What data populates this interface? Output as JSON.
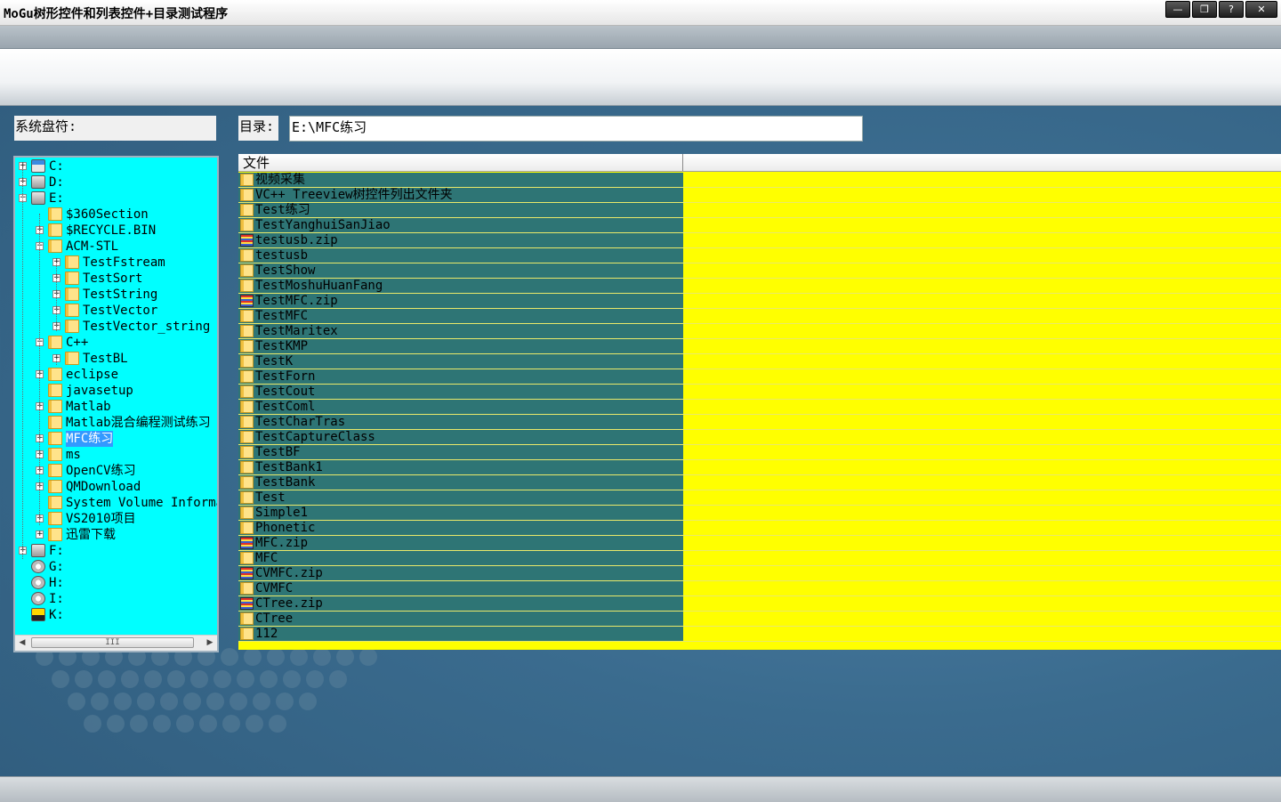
{
  "window": {
    "title": "MoGu树形控件和列表控件+目录测试程序",
    "buttons": {
      "minimize": "—",
      "restore": "❐",
      "help": "?",
      "close": "✕"
    }
  },
  "labels": {
    "drives": "系统盘符:",
    "directory": "目录:"
  },
  "directory_value": "E:\\MFC练习",
  "tree": {
    "items": [
      {
        "label": "C:",
        "level": 0,
        "icon": "drive-sys",
        "expander": "+"
      },
      {
        "label": "D:",
        "level": 0,
        "icon": "drive",
        "expander": "+"
      },
      {
        "label": "E:",
        "level": 0,
        "icon": "drive",
        "expander": "-"
      },
      {
        "label": "$360Section",
        "level": 1,
        "icon": "folder",
        "expander": ""
      },
      {
        "label": "$RECYCLE.BIN",
        "level": 1,
        "icon": "folder",
        "expander": "+"
      },
      {
        "label": "ACM-STL",
        "level": 1,
        "icon": "folder",
        "expander": "-"
      },
      {
        "label": "TestFstream",
        "level": 2,
        "icon": "folder",
        "expander": "+"
      },
      {
        "label": "TestSort",
        "level": 2,
        "icon": "folder",
        "expander": "+"
      },
      {
        "label": "TestString",
        "level": 2,
        "icon": "folder",
        "expander": "+"
      },
      {
        "label": "TestVector",
        "level": 2,
        "icon": "folder",
        "expander": "+"
      },
      {
        "label": "TestVector_string",
        "level": 2,
        "icon": "folder",
        "expander": "+"
      },
      {
        "label": "C++",
        "level": 1,
        "icon": "folder",
        "expander": "-"
      },
      {
        "label": "TestBL",
        "level": 2,
        "icon": "folder",
        "expander": "+"
      },
      {
        "label": "eclipse",
        "level": 1,
        "icon": "folder",
        "expander": "+"
      },
      {
        "label": "javasetup",
        "level": 1,
        "icon": "folder",
        "expander": ""
      },
      {
        "label": "Matlab",
        "level": 1,
        "icon": "folder",
        "expander": "+"
      },
      {
        "label": "Matlab混合编程测试练习",
        "level": 1,
        "icon": "folder",
        "expander": ""
      },
      {
        "label": "MFC练习",
        "level": 1,
        "icon": "folder",
        "expander": "+",
        "selected": true
      },
      {
        "label": "ms",
        "level": 1,
        "icon": "folder",
        "expander": "+"
      },
      {
        "label": "OpenCV练习",
        "level": 1,
        "icon": "folder",
        "expander": "+"
      },
      {
        "label": "QMDownload",
        "level": 1,
        "icon": "folder",
        "expander": "+"
      },
      {
        "label": "System Volume Information",
        "level": 1,
        "icon": "folder",
        "expander": ""
      },
      {
        "label": "VS2010项目",
        "level": 1,
        "icon": "folder",
        "expander": "+"
      },
      {
        "label": "迅雷下载",
        "level": 1,
        "icon": "folder",
        "expander": "+"
      },
      {
        "label": "F:",
        "level": 0,
        "icon": "drive",
        "expander": "+"
      },
      {
        "label": "G:",
        "level": 0,
        "icon": "drive-cd",
        "expander": ""
      },
      {
        "label": "H:",
        "level": 0,
        "icon": "drive-cd",
        "expander": ""
      },
      {
        "label": "I:",
        "level": 0,
        "icon": "drive-cd",
        "expander": ""
      },
      {
        "label": "K:",
        "level": 0,
        "icon": "drive-usb",
        "expander": ""
      }
    ],
    "scrollbar_grip": "III"
  },
  "list": {
    "header": "文件",
    "files": [
      {
        "name": "视频采集",
        "type": "folder"
      },
      {
        "name": "VC++ Treeview树控件列出文件夹",
        "type": "folder"
      },
      {
        "name": "Test练习",
        "type": "folder"
      },
      {
        "name": "TestYanghuiSanJiao",
        "type": "folder"
      },
      {
        "name": "testusb.zip",
        "type": "zip"
      },
      {
        "name": "testusb",
        "type": "folder"
      },
      {
        "name": "TestShow",
        "type": "folder"
      },
      {
        "name": "TestMoshuHuanFang",
        "type": "folder"
      },
      {
        "name": "TestMFC.zip",
        "type": "zip"
      },
      {
        "name": "TestMFC",
        "type": "folder"
      },
      {
        "name": "TestMaritex",
        "type": "folder"
      },
      {
        "name": "TestKMP",
        "type": "folder"
      },
      {
        "name": "TestK",
        "type": "folder"
      },
      {
        "name": "TestForn",
        "type": "folder"
      },
      {
        "name": "TestCout",
        "type": "folder"
      },
      {
        "name": "TestComl",
        "type": "folder"
      },
      {
        "name": "TestCharTras",
        "type": "folder"
      },
      {
        "name": "TestCaptureClass",
        "type": "folder"
      },
      {
        "name": "TestBF",
        "type": "folder"
      },
      {
        "name": "TestBank1",
        "type": "folder"
      },
      {
        "name": "TestBank",
        "type": "folder"
      },
      {
        "name": "Test",
        "type": "folder"
      },
      {
        "name": "Simple1",
        "type": "folder"
      },
      {
        "name": "Phonetic",
        "type": "folder"
      },
      {
        "name": "MFC.zip",
        "type": "zip"
      },
      {
        "name": "MFC",
        "type": "folder"
      },
      {
        "name": "CVMFC.zip",
        "type": "zip"
      },
      {
        "name": "CVMFC",
        "type": "folder"
      },
      {
        "name": "CTree.zip",
        "type": "zip"
      },
      {
        "name": "CTree",
        "type": "folder"
      },
      {
        "name": "112",
        "type": "folder"
      }
    ]
  },
  "colors": {
    "tree_bg": "#00ffff",
    "list_bg": "#ffff00",
    "name_col_bg": "#2e7575",
    "selection": "#3399ff"
  }
}
